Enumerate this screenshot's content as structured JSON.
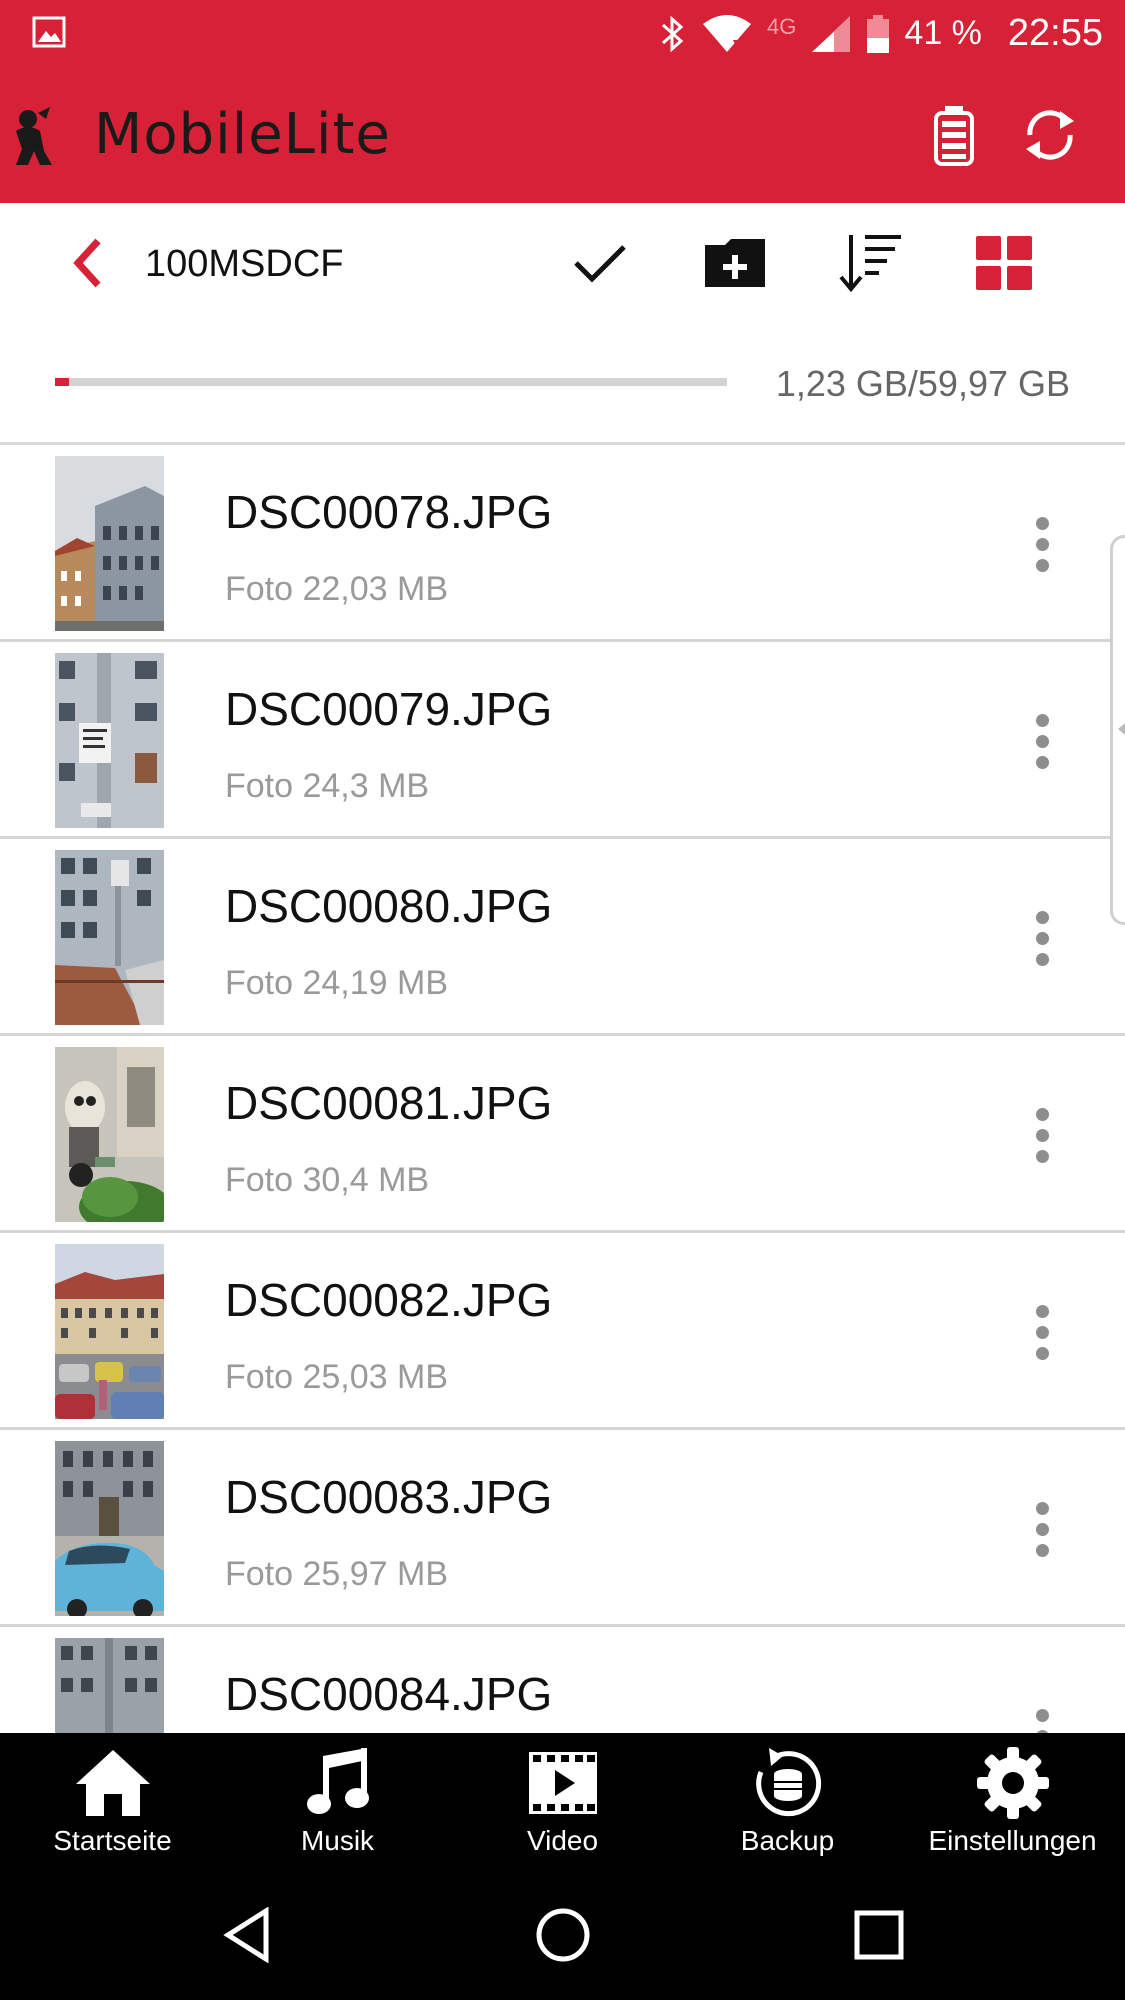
{
  "status_bar": {
    "network": "4G",
    "battery": "41 %",
    "time": "22:55"
  },
  "app": {
    "title": "MobileLite",
    "brand_color": "#d62136"
  },
  "toolbar": {
    "folder": "100MSDCF"
  },
  "storage": {
    "label": "1,23 GB/59,97 GB",
    "used_fraction": 0.0205
  },
  "files": [
    {
      "name": "DSC00078.JPG",
      "meta": "Foto 22,03 MB",
      "thumb": "street-houses"
    },
    {
      "name": "DSC00079.JPG",
      "meta": "Foto 24,3 MB",
      "thumb": "facade-pole"
    },
    {
      "name": "DSC00080.JPG",
      "meta": "Foto 24,19 MB",
      "thumb": "facade-roof"
    },
    {
      "name": "DSC00081.JPG",
      "meta": "Foto 30,4 MB",
      "thumb": "graffiti-wall"
    },
    {
      "name": "DSC00082.JPG",
      "meta": "Foto 25,03 MB",
      "thumb": "market-square"
    },
    {
      "name": "DSC00083.JPG",
      "meta": "Foto 25,97 MB",
      "thumb": "blue-car"
    },
    {
      "name": "DSC00084.JPG",
      "meta": "",
      "thumb": "grey-building"
    }
  ],
  "bottom_nav": [
    {
      "label": "Startseite",
      "icon": "home-icon"
    },
    {
      "label": "Musik",
      "icon": "music-icon"
    },
    {
      "label": "Video",
      "icon": "video-icon"
    },
    {
      "label": "Backup",
      "icon": "backup-icon"
    },
    {
      "label": "Einstellungen",
      "icon": "gear-icon"
    }
  ]
}
